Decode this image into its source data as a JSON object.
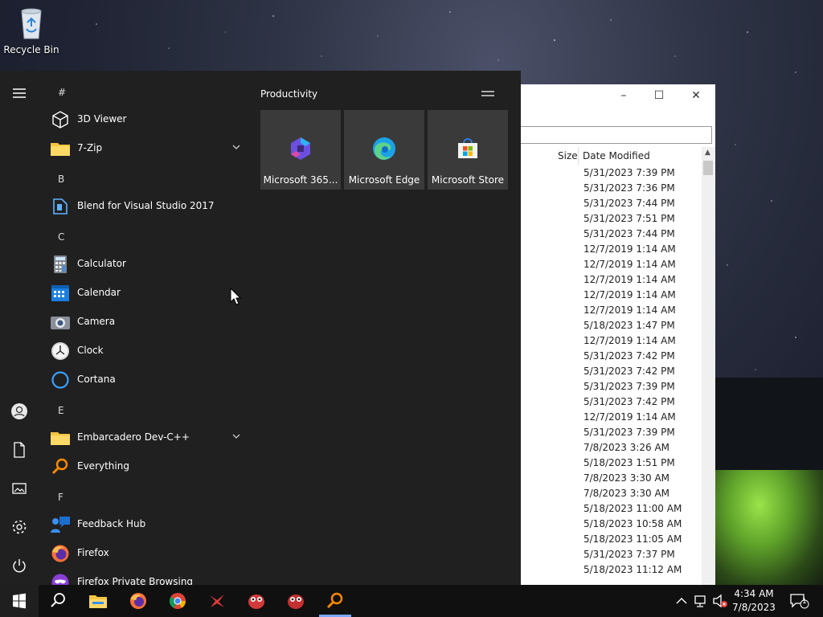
{
  "desktop": {
    "recycle_bin_label": "Recycle Bin"
  },
  "explorer": {
    "col_size": "Size",
    "col_date": "Date Modified",
    "dates": [
      "5/31/2023 7:39 PM",
      "5/31/2023 7:36 PM",
      "5/31/2023 7:44 PM",
      "5/31/2023 7:51 PM",
      "5/31/2023 7:44 PM",
      "12/7/2019 1:14 AM",
      "12/7/2019 1:14 AM",
      "12/7/2019 1:14 AM",
      "12/7/2019 1:14 AM",
      "12/7/2019 1:14 AM",
      "5/18/2023 1:47 PM",
      "12/7/2019 1:14 AM",
      "5/31/2023 7:42 PM",
      "5/31/2023 7:42 PM",
      "5/31/2023 7:39 PM",
      "5/31/2023 7:42 PM",
      "12/7/2019 1:14 AM",
      "5/31/2023 7:39 PM",
      "7/8/2023 3:26 AM",
      "5/18/2023 1:51 PM",
      "7/8/2023 3:30 AM",
      "7/8/2023 3:30 AM",
      "5/18/2023 11:00 AM",
      "5/18/2023 10:58 AM",
      "5/18/2023 11:05 AM",
      "5/31/2023 7:37 PM",
      "5/18/2023 11:12 AM"
    ]
  },
  "start_menu": {
    "letters": {
      "hash": "#",
      "b": "B",
      "c": "C",
      "e": "E",
      "f": "F"
    },
    "apps": {
      "viewer3d": "3D Viewer",
      "zip7": "7-Zip",
      "blend": "Blend for Visual Studio 2017",
      "calculator": "Calculator",
      "calendar": "Calendar",
      "camera": "Camera",
      "clock": "Clock",
      "cortana": "Cortana",
      "devcpp": "Embarcadero Dev-C++",
      "everything": "Everything",
      "feedback": "Feedback Hub",
      "firefox": "Firefox",
      "firefox_private": "Firefox Private Browsing"
    },
    "tiles_group": "Productivity",
    "tiles": {
      "m365": "Microsoft 365...",
      "edge": "Microsoft Edge",
      "store": "Microsoft Store"
    }
  },
  "taskbar": {
    "time": "4:34 AM",
    "date": "7/8/2023",
    "notification_count": "1"
  }
}
